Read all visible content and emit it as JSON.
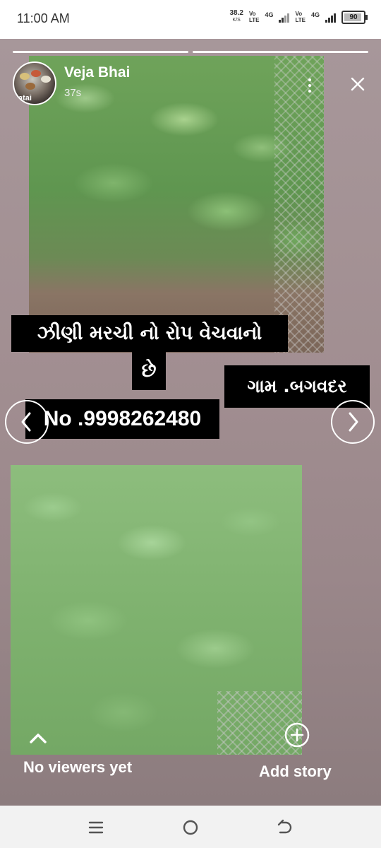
{
  "status_bar": {
    "time": "11:00 AM",
    "net_speed_value": "38.2",
    "net_speed_unit": "K/S",
    "volte1_top": "Vo",
    "volte1_bottom": "LTE",
    "network1": "4G",
    "volte2_top": "Vo",
    "volte2_bottom": "LTE",
    "network2": "4G",
    "battery": "90"
  },
  "story": {
    "username": "Veja Bhai",
    "time_ago": "37s",
    "avatar_tag": "atai",
    "progress_segments": 2,
    "captions": {
      "line1": "ઝીણી મરચી નો રોપ વેચવાનો",
      "line1b": "છે",
      "village": "ગામ .બગવદર",
      "phone": "No .9998262480"
    },
    "viewers_label": "No viewers yet",
    "add_story_label": "Add story"
  },
  "colors": {
    "caption_bg": "#000000",
    "caption_text": "#ffffff",
    "story_bg": "#a28f92"
  },
  "icons": {
    "close": "close-icon",
    "menu": "more-vertical-icon",
    "prev": "chevron-left-icon",
    "next": "chevron-right-icon",
    "viewers": "chevron-up-icon",
    "add_story": "add-circle-icon"
  }
}
